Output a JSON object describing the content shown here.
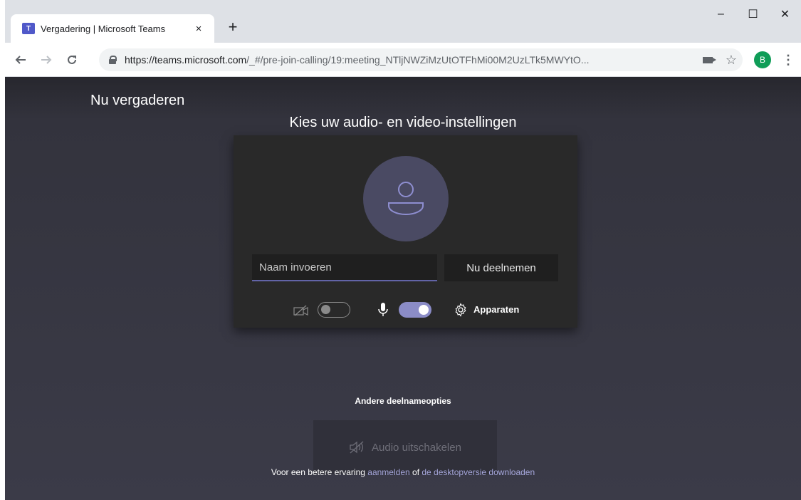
{
  "browser": {
    "tab_title": "Vergadering | Microsoft Teams",
    "tab_favicon": "T",
    "tab_close": "×",
    "new_tab": "+",
    "url_base": "https://teams.microsoft.com",
    "url_path": "/_#/pre-join-calling/19:meeting_NTljNWZiMzUtOTFhMi00M2UzLTk5MWYtO...",
    "profile_initial": "B",
    "window_controls": [
      "–",
      "☐",
      "✕"
    ],
    "icons": [
      "back-arrow-icon",
      "forward-arrow-icon",
      "reload-icon",
      "lock-icon",
      "camera-icon",
      "star-icon",
      "kebab-menu-icon"
    ]
  },
  "page": {
    "heading": "Nu vergaderen",
    "title": "Kies uw audio- en video-instellingen",
    "name_placeholder": "Naam invoeren",
    "join_button": "Nu deelnemen",
    "video_toggle_on": false,
    "audio_toggle_on": true,
    "devices_label": "Apparaten",
    "other_options": "Andere deelnameopties",
    "audio_off_button": "Audio uitschakelen",
    "footer_prefix": "Voor een betere ervaring",
    "footer_link_login": "aanmelden",
    "footer_middle": "of",
    "footer_link_download": "de desktopversie downloaden"
  },
  "colors": {
    "accent": "#6264a7",
    "toggle_on": "#8b8cc7",
    "link": "#a6a7dc",
    "panel": "#292929"
  }
}
